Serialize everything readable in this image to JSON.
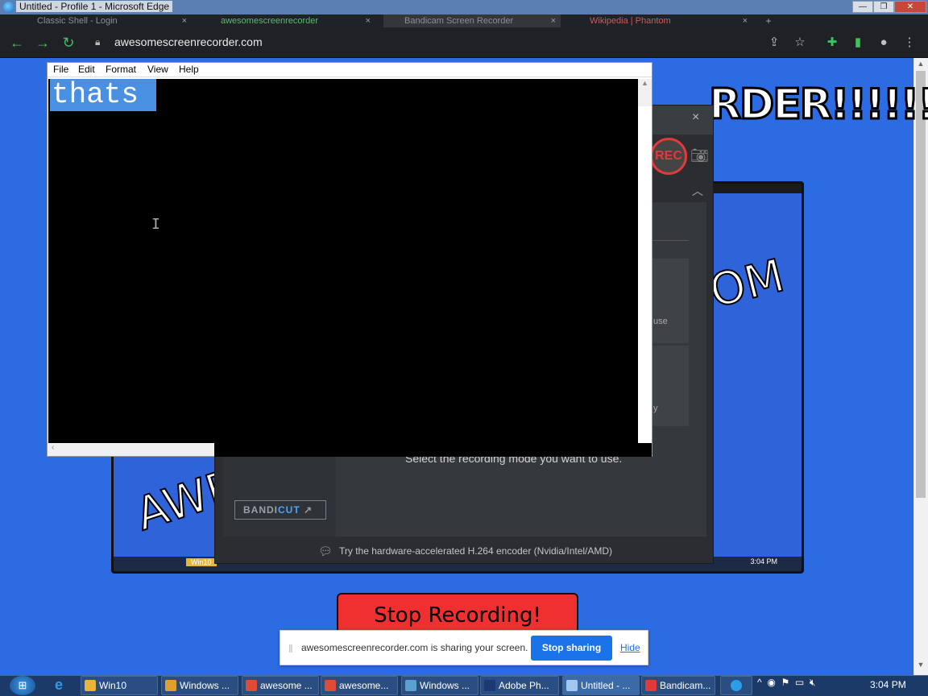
{
  "window": {
    "title": "Untitled - Profile 1 - Microsoft Edge"
  },
  "tabs": [
    {
      "label": "Classic Shell - Login"
    },
    {
      "label": "awesomescreenrecorder"
    },
    {
      "label": "Bandicam Screen Recorder"
    },
    {
      "label": "Wikipedia | Phantom"
    }
  ],
  "address": {
    "url": "awesomescreenrecorder.com"
  },
  "webpage": {
    "headline": "RDER!!!!!!",
    "nested_text_left": "AWE",
    "nested_text_right": "OM",
    "nested_clock": "3:04 PM",
    "nested_task": "Win10",
    "stop_label": "Stop Recording!"
  },
  "bandicam": {
    "rec_label": "REC",
    "card1_fragment": "use",
    "card2_fragment": "y",
    "mode_text": "Select the recording mode you want to use.",
    "bandicut_a": "BANDI",
    "bandicut_b": "CUT",
    "footer_text": "Try the hardware-accelerated H.264 encoder (Nvidia/Intel/AMD)"
  },
  "notepad": {
    "menu": [
      "File",
      "Edit",
      "Format",
      "View",
      "Help"
    ],
    "content": "thats"
  },
  "sharebar": {
    "message": "awesomescreenrecorder.com is sharing your screen.",
    "stop_label": "Stop sharing",
    "hide_label": "Hide"
  },
  "taskbar": {
    "items": [
      {
        "label": "Win10",
        "color": "#e6b53a"
      },
      {
        "label": "Windows ...",
        "color": "#e0a030"
      },
      {
        "label": "awesome ...",
        "color": "#dd4b39"
      },
      {
        "label": "awesome...",
        "color": "#dd4b39"
      },
      {
        "label": "Windows ...",
        "color": "#5aa0d0"
      },
      {
        "label": "Adobe Ph...",
        "color": "#1b3a75"
      },
      {
        "label": "Untitled - ...",
        "color": "#a0c8f0"
      },
      {
        "label": "Bandicam...",
        "color": "#e03a3a"
      }
    ],
    "clock": "3:04 PM"
  },
  "colors": {
    "accent": "#1a73e8",
    "stop_button": "#f03030",
    "page_bg": "#2d6be3"
  }
}
